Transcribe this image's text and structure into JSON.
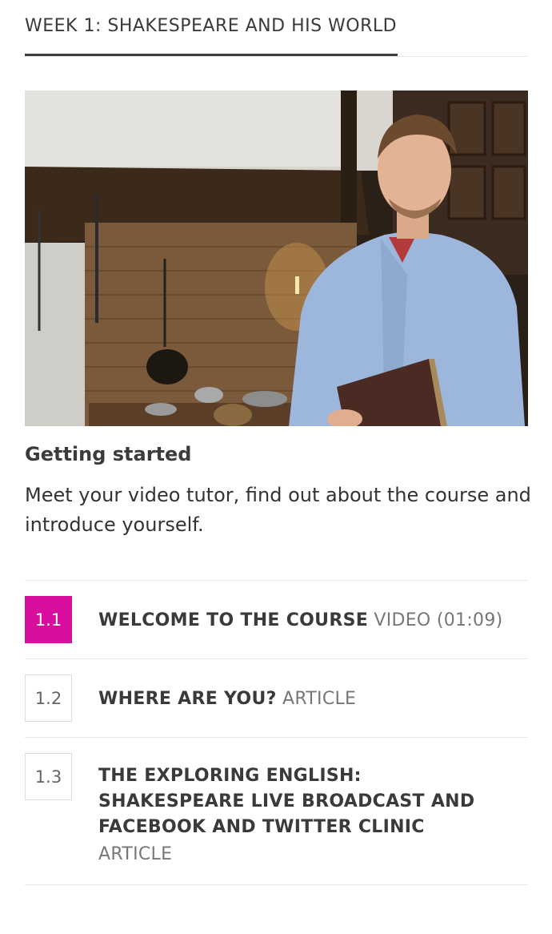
{
  "week": {
    "title": "WEEK 1: SHAKESPEARE AND HIS WORLD"
  },
  "activity": {
    "title": "Getting started",
    "description": "Meet your video tutor, find out about the course and introduce yourself."
  },
  "steps": [
    {
      "number": "1.1",
      "title": "WELCOME TO THE COURSE",
      "type": "VIDEO",
      "duration": "(01:09)",
      "active": true
    },
    {
      "number": "1.2",
      "title": "WHERE ARE YOU?",
      "type": "ARTICLE",
      "active": false
    },
    {
      "number": "1.3",
      "title": "THE EXPLORING ENGLISH: SHAKESPEARE LIVE BROADCAST AND FACEBOOK AND TWITTER CLINIC",
      "type": "ARTICLE",
      "active": false
    }
  ],
  "colors": {
    "active_step": "#d80d9e",
    "underline": "#3d3d3d",
    "divider": "#e6e6e6"
  }
}
